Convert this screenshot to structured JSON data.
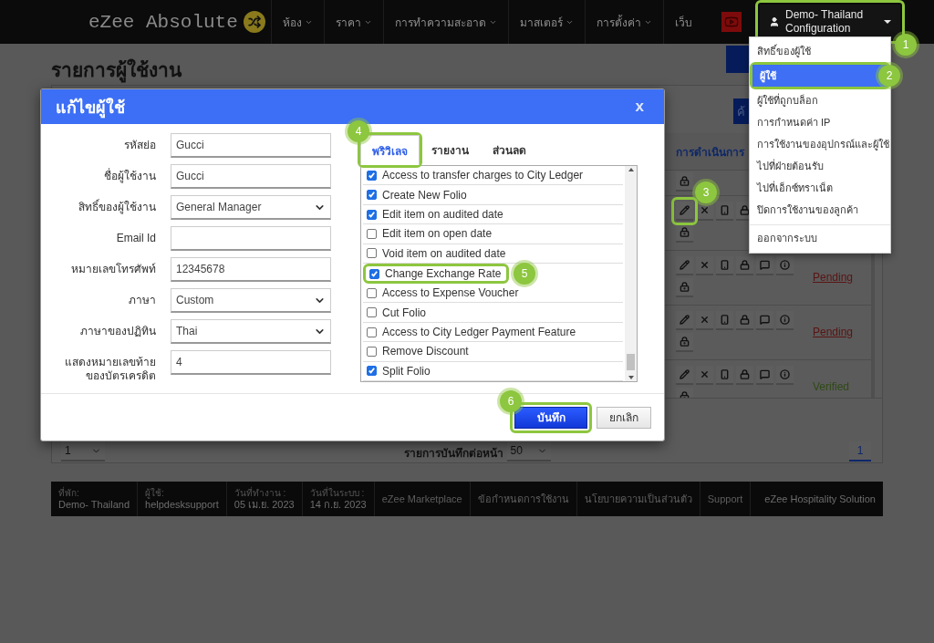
{
  "navbar": {
    "logo": "eZee Absolute",
    "menus": [
      {
        "label": "ห้อง",
        "has_caret": true
      },
      {
        "label": "ราคา",
        "has_caret": true
      },
      {
        "label": "การทำความสะอาด",
        "has_caret": true
      },
      {
        "label": "มาสเตอร์",
        "has_caret": true
      },
      {
        "label": "การตั้งค่า",
        "has_caret": true
      },
      {
        "label": "เว็บ",
        "has_caret": false
      }
    ],
    "user_menu": {
      "property": "Demo- Thailand",
      "label": "Configuration",
      "callout": "1",
      "expanded": true
    }
  },
  "dropdown": {
    "items": [
      {
        "label": "สิทธิ์ของผู้ใช้",
        "selected": false
      },
      {
        "label": "ผู้ใช้",
        "selected": true,
        "callout": "2"
      },
      {
        "label": "ผู้ใช้ที่ถูกบล็อก",
        "selected": false
      },
      {
        "label": "การกำหนดค่า IP",
        "selected": false
      },
      {
        "label": "การใช้งานของอุปกรณ์และผู้ใช้",
        "selected": false
      },
      {
        "label": "ไปที่ฝ่ายต้อนรับ",
        "selected": false
      },
      {
        "label": "ไปที่เอ็กซ์ทราเน็ต",
        "selected": false
      },
      {
        "label": "ปิดการใช้งานของลูกค้า",
        "selected": false
      }
    ],
    "logout": "ออกจากระบบ"
  },
  "page": {
    "title": "รายการผู้ใช้งาน",
    "search_button": "ค้",
    "table": {
      "actions_header": "การดำเนินการ",
      "rows": [
        {
          "callout": "3"
        },
        {
          "status": "Pending",
          "color": "#5a1414"
        },
        {
          "status": "Pending",
          "color": "#5a1414"
        },
        {
          "status": "Verified",
          "color": "#2f4a16"
        }
      ]
    },
    "pagination": {
      "page_select": "1",
      "per_page_label": "รายการบันทึกต่อหน้า",
      "per_page": "50",
      "pages": [
        {
          "label": "1",
          "selected": true
        }
      ]
    }
  },
  "footer": {
    "info": [
      {
        "label": "ที่พัก:",
        "value": "Demo- Thailand"
      },
      {
        "label": "ผู้ใช้:",
        "value": "helpdesksupport"
      },
      {
        "label": "วันที่ทำงาน :",
        "value": "05 เม.ย. 2023"
      },
      {
        "label": "วันที่ในระบบ :",
        "value": "14 ก.ย. 2023"
      }
    ],
    "links": [
      "eZee Marketplace",
      "ข้อกำหนดการใช้งาน",
      "นโยบายความเป็นส่วนตัว",
      "Support"
    ],
    "brand": "eZee Hospitality Solution"
  },
  "dialog": {
    "title": "แก้ไขผู้ใช้",
    "close": "x",
    "fields": [
      {
        "label": "รหัสย่อ",
        "value": "Gucci",
        "kind": "text"
      },
      {
        "label": "ชื่อผู้ใช้งาน",
        "value": "Gucci",
        "kind": "text"
      },
      {
        "label": "สิทธิ์ของผู้ใช้งาน",
        "value": "General Manager",
        "kind": "select"
      },
      {
        "label": "Email Id",
        "kind": "text"
      },
      {
        "label": "หมายเลขโทรศัพท์",
        "value": "12345678",
        "kind": "text"
      },
      {
        "label": "ภาษา",
        "value": "Custom",
        "kind": "select"
      },
      {
        "label": "ภาษาของปฏิทิน",
        "value": "Thai",
        "kind": "select"
      },
      {
        "label": "แสดงหมายเลขท้ายของบัตรเครดิต",
        "value": "4",
        "kind": "text"
      }
    ],
    "tabs": [
      {
        "label": "พริวิเลจ",
        "selected": true,
        "callout": "4"
      },
      {
        "label": "รายงาน",
        "selected": false
      },
      {
        "label": "ส่วนลด",
        "selected": false
      }
    ],
    "privileges": [
      {
        "label": "Access to transfer charges to City Ledger",
        "checked": true
      },
      {
        "label": "Create New Folio",
        "checked": true
      },
      {
        "label": "Edit item on audited date",
        "checked": true
      },
      {
        "label": "Edit item on open date",
        "checked": false
      },
      {
        "label": "Void item on audited date",
        "checked": false
      },
      {
        "label": "Change Exchange Rate",
        "checked": true,
        "callout": "5"
      },
      {
        "label": "Access to Expense Voucher",
        "checked": false
      },
      {
        "label": "Cut Folio",
        "checked": false
      },
      {
        "label": "Access to City Ledger Payment Feature",
        "checked": false
      },
      {
        "label": "Remove Discount",
        "checked": false
      },
      {
        "label": "Split Folio",
        "checked": true
      }
    ],
    "save": {
      "label": "บันทึก",
      "callout": "6"
    },
    "cancel": "ยกเลิก"
  }
}
